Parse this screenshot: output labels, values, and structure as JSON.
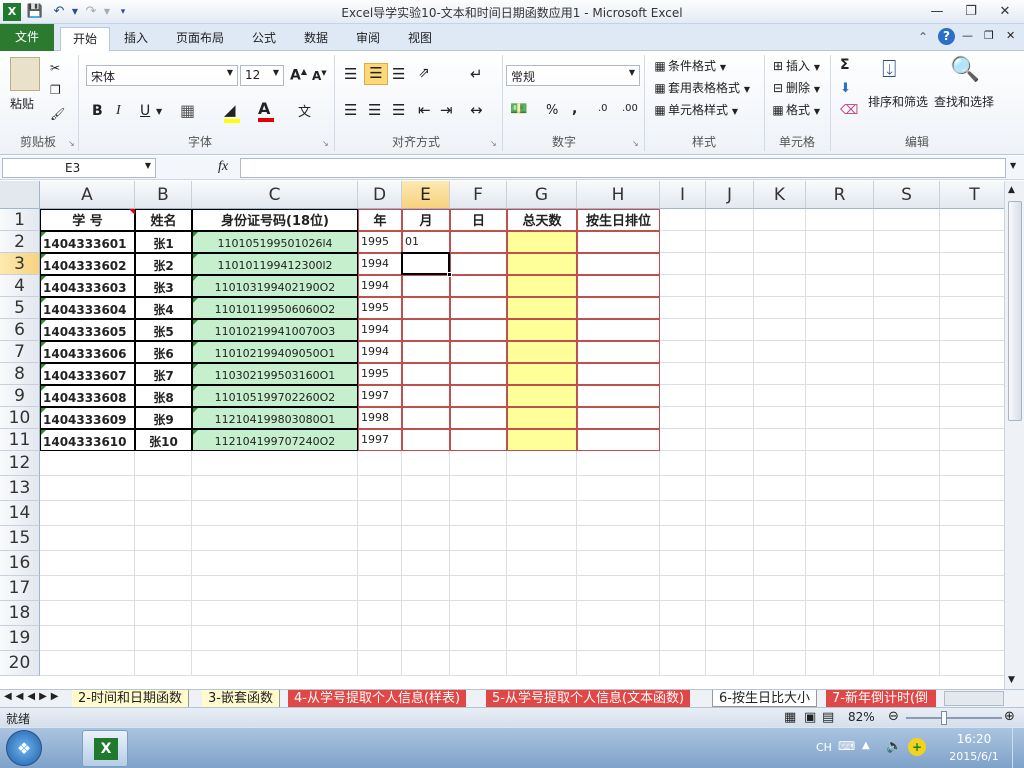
{
  "window": {
    "title": "Excel导学实验10-文本和时间日期函数应用1  -  Microsoft Excel"
  },
  "ribbon": {
    "tabs": [
      "文件",
      "开始",
      "插入",
      "页面布局",
      "公式",
      "数据",
      "审阅",
      "视图"
    ],
    "clipboard": {
      "label": "剪贴板",
      "paste": "粘贴"
    },
    "font": {
      "label": "字体",
      "name": "宋体",
      "size": "12",
      "bold": "B",
      "italic": "I",
      "underline": "U"
    },
    "align": {
      "label": "对齐方式"
    },
    "number": {
      "label": "数字",
      "format": "常规",
      "percent": "%",
      "comma": ","
    },
    "styles": {
      "label": "样式",
      "cond": "条件格式",
      "table": "套用表格格式",
      "cell": "单元格样式"
    },
    "cells": {
      "label": "单元格",
      "insert": "插入",
      "delete": "删除",
      "format": "格式"
    },
    "edit": {
      "label": "编辑",
      "sort": "排序和筛选",
      "find": "查找和选择",
      "sigma": "Σ"
    }
  },
  "formula_bar": {
    "name_box": "E3",
    "fx": "fx",
    "value": ""
  },
  "columns": [
    {
      "id": "A",
      "w": 95
    },
    {
      "id": "B",
      "w": 57
    },
    {
      "id": "C",
      "w": 166
    },
    {
      "id": "D",
      "w": 44
    },
    {
      "id": "E",
      "w": 48
    },
    {
      "id": "F",
      "w": 57
    },
    {
      "id": "G",
      "w": 70
    },
    {
      "id": "H",
      "w": 83
    },
    {
      "id": "I",
      "w": 46
    },
    {
      "id": "J",
      "w": 48
    },
    {
      "id": "K",
      "w": 52
    },
    {
      "id": "R",
      "w": 68
    },
    {
      "id": "S",
      "w": 66
    },
    {
      "id": "T",
      "w": 70
    }
  ],
  "rows": [
    "1",
    "2",
    "3",
    "4",
    "5",
    "6",
    "7",
    "8",
    "9",
    "10",
    "11",
    "12",
    "13",
    "14",
    "15",
    "16",
    "17",
    "18",
    "19",
    "20"
  ],
  "headers": {
    "A": "学  号",
    "B": "姓名",
    "C": "身份证号码(18位)",
    "D": "年",
    "E": "月",
    "F": "日",
    "G": "总天数",
    "H": "按生日排位"
  },
  "records": [
    {
      "id": "1404333601",
      "name": "张1",
      "card": "110105199501026l4",
      "year": "1995",
      "month": "01"
    },
    {
      "id": "1404333602",
      "name": "张2",
      "card": "110101199412300l2",
      "year": "1994",
      "month": ""
    },
    {
      "id": "1404333603",
      "name": "张3",
      "card": "110103199402190O2",
      "year": "1994",
      "month": ""
    },
    {
      "id": "1404333604",
      "name": "张4",
      "card": "110101199506060O2",
      "year": "1995",
      "month": ""
    },
    {
      "id": "1404333605",
      "name": "张5",
      "card": "110102199410070O3",
      "year": "1994",
      "month": ""
    },
    {
      "id": "1404333606",
      "name": "张6",
      "card": "110102199409050O1",
      "year": "1994",
      "month": ""
    },
    {
      "id": "1404333607",
      "name": "张7",
      "card": "110302199503160O1",
      "year": "1995",
      "month": ""
    },
    {
      "id": "1404333608",
      "name": "张8",
      "card": "110105199702260O2",
      "year": "1997",
      "month": ""
    },
    {
      "id": "1404333609",
      "name": "张9",
      "card": "112104199803080O1",
      "year": "1998",
      "month": ""
    },
    {
      "id": "1404333610",
      "name": "张10",
      "card": "112104199707240O2",
      "year": "1997",
      "month": ""
    }
  ],
  "sheets": [
    "2-时间和日期函数",
    "3-嵌套函数",
    "4-从学号提取个人信息(样表)",
    "5-从学号提取个人信息(文本函数)",
    "6-按生日比大小",
    "7-新年倒计时(倒"
  ],
  "status": {
    "ready": "就绪",
    "zoom": "82%"
  },
  "taskbar": {
    "lang": "CH",
    "time": "16:20",
    "date": "2015/6/1"
  },
  "colors": {
    "accent": "#2b7a30",
    "green_fill": "#c6efce",
    "yellow_fill": "#ffff99",
    "red_border": "#c0504d",
    "tab_red": "#e04848"
  }
}
